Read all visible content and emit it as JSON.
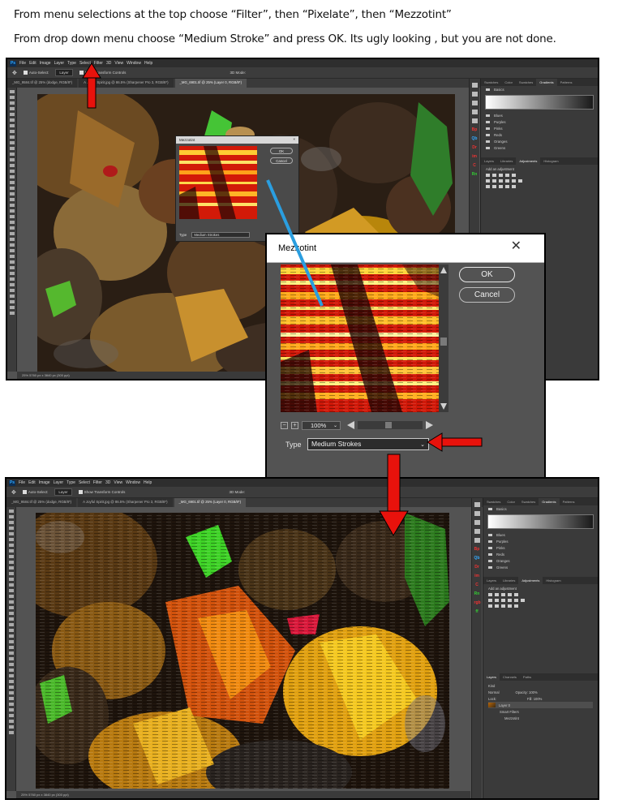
{
  "instructions": {
    "line1": "From menu  selections at the top choose “Filter”, then “Pixelate”, then “Mezzotint”",
    "line2": "From drop down menu choose “Medium Stroke” and press OK.  Its ugly looking , but you are not done."
  },
  "menubar": {
    "logo": "Ps",
    "items": [
      "File",
      "Edit",
      "Image",
      "Layer",
      "Type",
      "Select",
      "Filter",
      "3D",
      "View",
      "Window",
      "Help"
    ]
  },
  "options_bar": {
    "auto_select_label": "Auto-Select:",
    "auto_select_value": "Layer",
    "transform_controls_label": "Show Transform Controls",
    "mode_label": "3D Mode:"
  },
  "tabs_top": [
    "_MG_9584.tif @ 25% (dodge, RGB/8*)",
    "A Joyful Spirit.jpg @ 86.5% (Sharpener Pro 3, RGB/8*)",
    "_MG_6901.tif @ 25% (Layer 0, RGB/8*)"
  ],
  "tabs_bottom": [
    "_MG_9584.tif @ 25% (dodge, RGB/8*)",
    "A Joyful Spirit.jpg @ 86.5% (Sharpener Pro 3, RGB/8*)",
    "_MG_6901.tif @ 25% (Layer 0, RGB/8*)"
  ],
  "status_top": "25%    5760 px x 3840 px (300 ppi)",
  "status_bottom": "25%    5760 px x 3840 px (300 ppi)",
  "right_panel": {
    "tabs": [
      "Swatches",
      "Color",
      "Swatches",
      "Gradients",
      "Patterns"
    ],
    "active_tab": "Gradients",
    "folder_basics": "Basics",
    "folders": [
      "Blues",
      "Purples",
      "Pinks",
      "Reds",
      "Oranges",
      "Greens"
    ],
    "lower_tabs": [
      "Layers",
      "Libraries",
      "Adjustments",
      "Histogram"
    ],
    "adjust_label": "Add an adjustment",
    "layers_tabs": [
      "Layers",
      "Channels",
      "Paths"
    ],
    "kind_label": "Kind",
    "blend_mode": "Normal",
    "opacity_label": "Opacity: 100%",
    "lock_label": "Lock:",
    "fill_label": "Fill: 100%",
    "layer_name": "Layer 0",
    "smart_filters_label": "Smart Filters",
    "filter_name": "Mezzotint"
  },
  "mini_dialog": {
    "title": "Mezzotint",
    "ok": "OK",
    "cancel": "Cancel",
    "type_label": "Type",
    "type_value": "Medium Strokes",
    "zoom": "100%"
  },
  "big_dialog": {
    "title": "Mezzotint",
    "close": "✕",
    "ok": "OK",
    "cancel": "Cancel",
    "zoom": "100%",
    "type_label": "Type",
    "type_value": "Medium Strokes"
  },
  "colors": {
    "annotation_red": "#e8120c",
    "annotation_blue": "#2a9ee0",
    "ps_panel": "#535353",
    "ps_dark": "#2e2e2e"
  }
}
